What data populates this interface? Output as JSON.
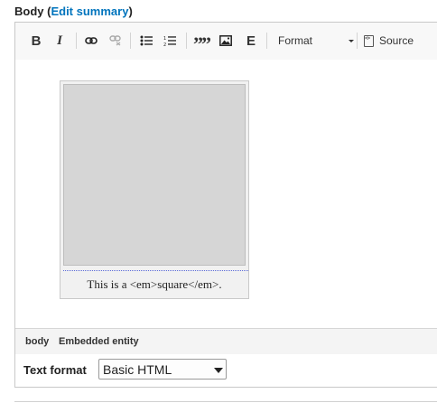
{
  "field": {
    "label": "Body",
    "paren_open": " (",
    "edit_summary_link": "Edit summary",
    "paren_close": ")"
  },
  "toolbar": {
    "bold": "B",
    "italic": "I",
    "blockquote": "”",
    "entity_embed": "E",
    "format_label": "Format",
    "source_label": "Source",
    "icons": [
      "bold-icon",
      "italic-icon",
      "link-icon",
      "unlink-icon",
      "bulleted-list-icon",
      "numbered-list-icon",
      "blockquote-icon",
      "image-icon",
      "entity-embed-icon",
      "source-icon"
    ]
  },
  "content": {
    "caption": "This is a <em>square</em>."
  },
  "pathbar": {
    "items": [
      "body",
      "Embedded entity"
    ]
  },
  "text_format": {
    "label": "Text format",
    "selected": "Basic HTML"
  },
  "colors": {
    "link": "#0074bd",
    "toolbar_bg": "#f8f8f8",
    "placeholder_square": "#d6d6d6"
  }
}
